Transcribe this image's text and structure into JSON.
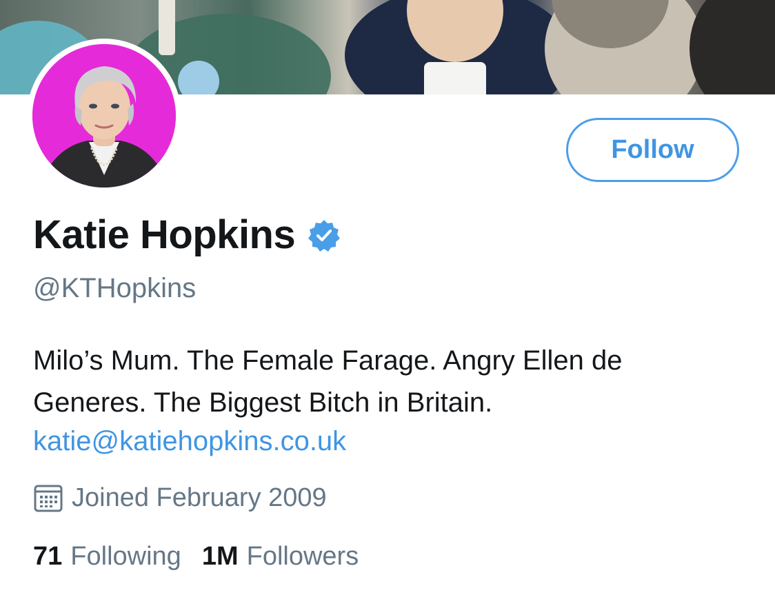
{
  "profile": {
    "display_name": "Katie Hopkins",
    "verified": true,
    "handle": "@KTHopkins",
    "bio_line1": "Milo’s Mum. The Female Farage. Angry Ellen de",
    "bio_line2": "Generes. The Biggest Bitch in Britain.",
    "bio_link": "katie@katiehopkins.co.uk",
    "joined": "Joined February 2009"
  },
  "actions": {
    "follow_label": "Follow"
  },
  "stats": {
    "following_count": "71",
    "following_label": "Following",
    "followers_count": "1M",
    "followers_label": "Followers"
  },
  "icons": {
    "verified": "verified-badge-icon",
    "joined": "calendar-icon"
  },
  "colors": {
    "accent_blue": "#3f95e3",
    "name_text": "#14171a",
    "secondary_text": "#657786",
    "avatar_bg": "#e52bd9"
  }
}
